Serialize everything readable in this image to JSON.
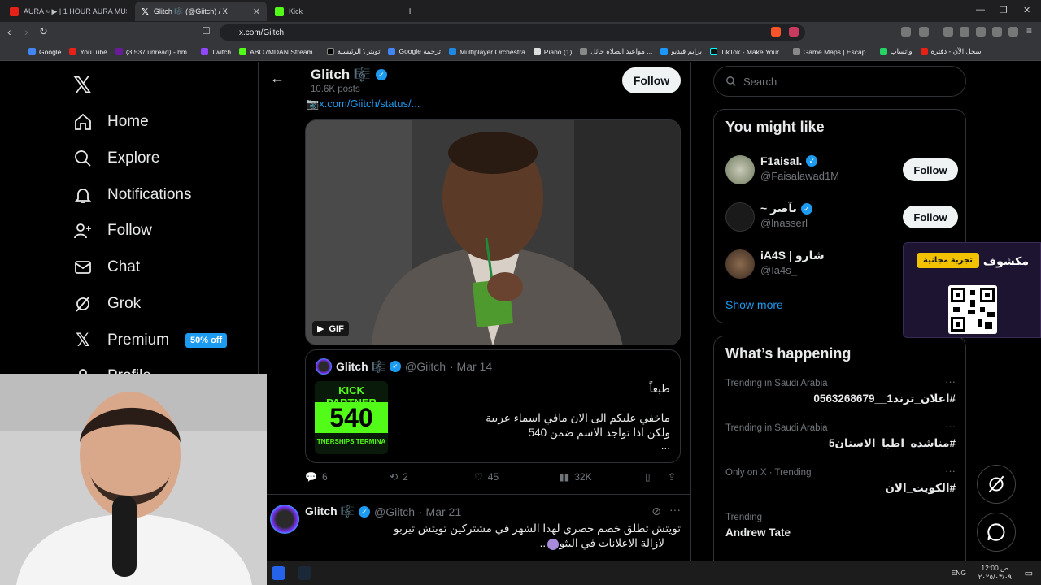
{
  "browser": {
    "tabs": [
      {
        "label": "AURA ≈ ▶ | 1 HOUR AURA MUSIC |",
        "active": false
      },
      {
        "label": "Glitch 🎼 (@Giitch) / X",
        "active": true
      },
      {
        "label": "Kick",
        "active": false
      }
    ],
    "url": "x.com/Giitch",
    "bookmarks": [
      "Google",
      "YouTube",
      "(3,537 unread) - hm...",
      "Twitch",
      "ABO7MDAN Stream...",
      "تويتر \\ الرئيسية",
      "Google ترجمة",
      "Multiplayer Orchestra",
      "Piano (1)",
      "مواعيد الصلاه حائل ...",
      "برايم فيديو",
      "TikTok - Make Your...",
      "Game Maps | Escap...",
      "واتساب",
      "سجل الآن - دفترة"
    ]
  },
  "nav": {
    "items": [
      {
        "label": "Home",
        "icon": "home-icon"
      },
      {
        "label": "Explore",
        "icon": "search-icon"
      },
      {
        "label": "Notifications",
        "icon": "bell-icon"
      },
      {
        "label": "Follow",
        "icon": "follow-icon"
      },
      {
        "label": "Chat",
        "icon": "mail-icon"
      },
      {
        "label": "Grok",
        "icon": "grok-icon"
      },
      {
        "label": "Premium",
        "icon": "x-icon"
      },
      {
        "label": "Profile",
        "icon": "person-icon"
      }
    ],
    "premium_badge": "50% off"
  },
  "profile_header": {
    "name": "Glitch 🎼",
    "posts": "10.6K posts",
    "follow_label": "Follow"
  },
  "tweet": {
    "status_link": "x.com/Giitch/status/...",
    "gif_label": "GIF",
    "quote": {
      "name": "Glitch 🎼",
      "handle": "@Giitch",
      "date": "· Mar 14",
      "line1": "طبعاً",
      "line2": "ماخفي عليكم الى الان مافي اسماء عربية",
      "line3": "ولكن اذا تواجد الاسم ضمن 540",
      "line4": "...",
      "thumb_top": "KICK PARTNER",
      "thumb_num": "540",
      "thumb_bottom": "TNERSHIPS TERMINA"
    },
    "replies": "6",
    "retweets": "2",
    "likes": "45",
    "views": "32K"
  },
  "tweet2": {
    "name": "Glitch 🎼",
    "handle": "@Giitch",
    "date": "· Mar 21",
    "line1": "تويتش تطلق خصم حصري لهذا الشهر في مشتركين تويتش تيربو",
    "line2": "لازالة الاعلانات في البثوث .."
  },
  "right": {
    "search_placeholder": "Search",
    "wtf_title": "You might like",
    "suggestions": [
      {
        "name": "F1aisal.",
        "handle": "@Faisalawad1M",
        "follow": "Follow"
      },
      {
        "name": "~ نآصر",
        "handle": "@lnasserl",
        "follow": "Follow"
      },
      {
        "name": "iA4S | شارو",
        "handle": "@Ia4s_",
        "follow": ""
      }
    ],
    "show_more": "Show more",
    "happening_title": "What’s happening",
    "trends": [
      {
        "context": "Trending in Saudi Arabia",
        "name": "#اعلان_ترند1__0563268679"
      },
      {
        "context": "Trending in Saudi Arabia",
        "name": "#مناشده_اطبا_الاسنان5"
      },
      {
        "context": "Only on X · Trending",
        "name": "#الكويت_الان"
      },
      {
        "context": "Trending",
        "name": "Andrew Tate"
      }
    ]
  },
  "promo": {
    "title": "مكشوف",
    "button": "تجربة مجانية"
  },
  "taskbar": {
    "lang": "ENG",
    "time": "12:00 ص",
    "date": "٢٠٢٥/٠٣/٠٩"
  }
}
